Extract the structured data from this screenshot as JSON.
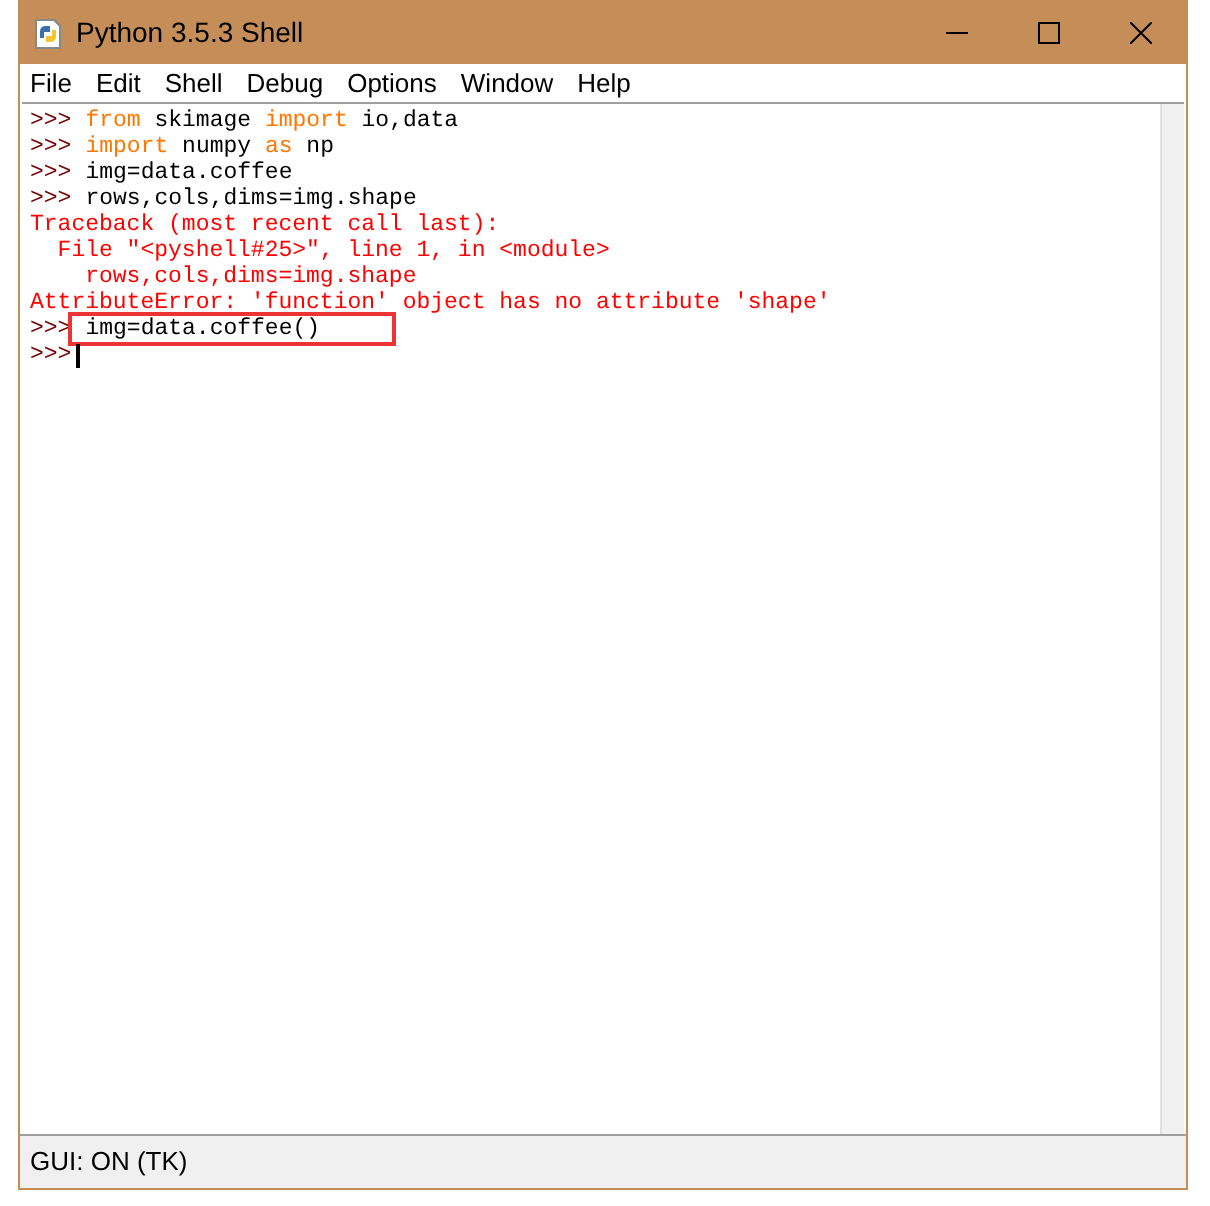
{
  "window": {
    "title": "Python 3.5.3 Shell"
  },
  "menu": [
    "File",
    "Edit",
    "Shell",
    "Debug",
    "Options",
    "Window",
    "Help"
  ],
  "lines": [
    {
      "kind": "input",
      "prompt": ">>>",
      "highlighted": false,
      "segments": [
        {
          "kind": "keyword",
          "text": "from"
        },
        {
          "kind": "plain",
          "text": " skimage "
        },
        {
          "kind": "keyword",
          "text": "import"
        },
        {
          "kind": "plain",
          "text": " io,data"
        }
      ]
    },
    {
      "kind": "input",
      "prompt": ">>>",
      "highlighted": false,
      "segments": [
        {
          "kind": "keyword",
          "text": "import"
        },
        {
          "kind": "plain",
          "text": " numpy "
        },
        {
          "kind": "keyword",
          "text": "as"
        },
        {
          "kind": "plain",
          "text": " np"
        }
      ]
    },
    {
      "kind": "input",
      "prompt": ">>>",
      "highlighted": false,
      "segments": [
        {
          "kind": "plain",
          "text": "img=data.coffee"
        }
      ]
    },
    {
      "kind": "input",
      "prompt": ">>>",
      "highlighted": false,
      "segments": [
        {
          "kind": "plain",
          "text": "rows,cols,dims=img.shape"
        }
      ]
    },
    {
      "kind": "error",
      "text": "Traceback (most recent call last):"
    },
    {
      "kind": "error",
      "text": "  File \"<pyshell#25>\", line 1, in <module>"
    },
    {
      "kind": "error",
      "text": "    rows,cols,dims=img.shape"
    },
    {
      "kind": "error",
      "text": "AttributeError: 'function' object has no attribute 'shape'"
    },
    {
      "kind": "input",
      "prompt": ">>>",
      "highlighted": true,
      "segments": [
        {
          "kind": "plain",
          "text": "img=data.coffee()"
        }
      ]
    },
    {
      "kind": "cursor",
      "prompt": ">>>"
    }
  ],
  "status_bar": {
    "text": "GUI: ON (TK)"
  }
}
